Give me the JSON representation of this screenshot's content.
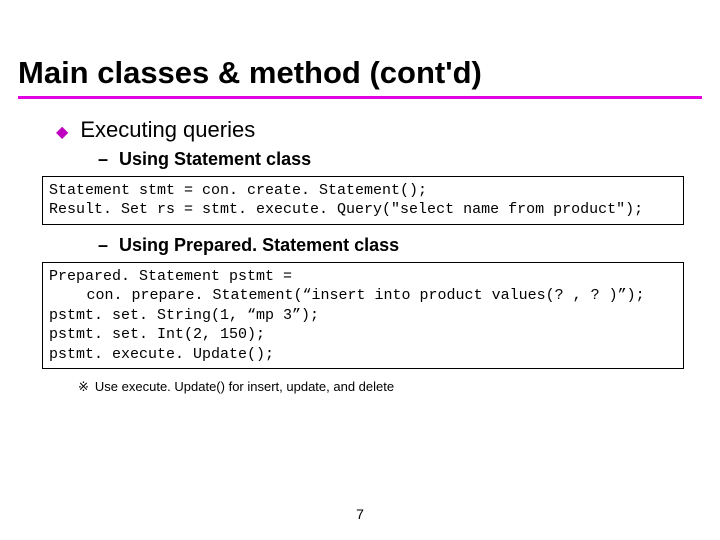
{
  "title": "Main classes & method (cont'd)",
  "level1": {
    "text": "Executing queries"
  },
  "level2a": {
    "text": "Using Statement class"
  },
  "code1": {
    "l1": "Statement stmt = con. create. Statement();",
    "l2": "Result. Set rs = stmt. execute. Query(\"select name from product\");"
  },
  "level2b": {
    "text": "Using Prepared. Statement class"
  },
  "code2": {
    "l1": "Prepared. Statement pstmt =",
    "l2": "con. prepare. Statement(“insert into product values(? , ? )”);",
    "l3": "pstmt. set. String(1, “mp 3”);",
    "l4": "pstmt. set. Int(2, 150);",
    "l5": "pstmt. execute. Update();"
  },
  "note": {
    "sym": "※",
    "text": "Use execute. Update() for insert, update, and delete"
  },
  "pagenum": "7"
}
